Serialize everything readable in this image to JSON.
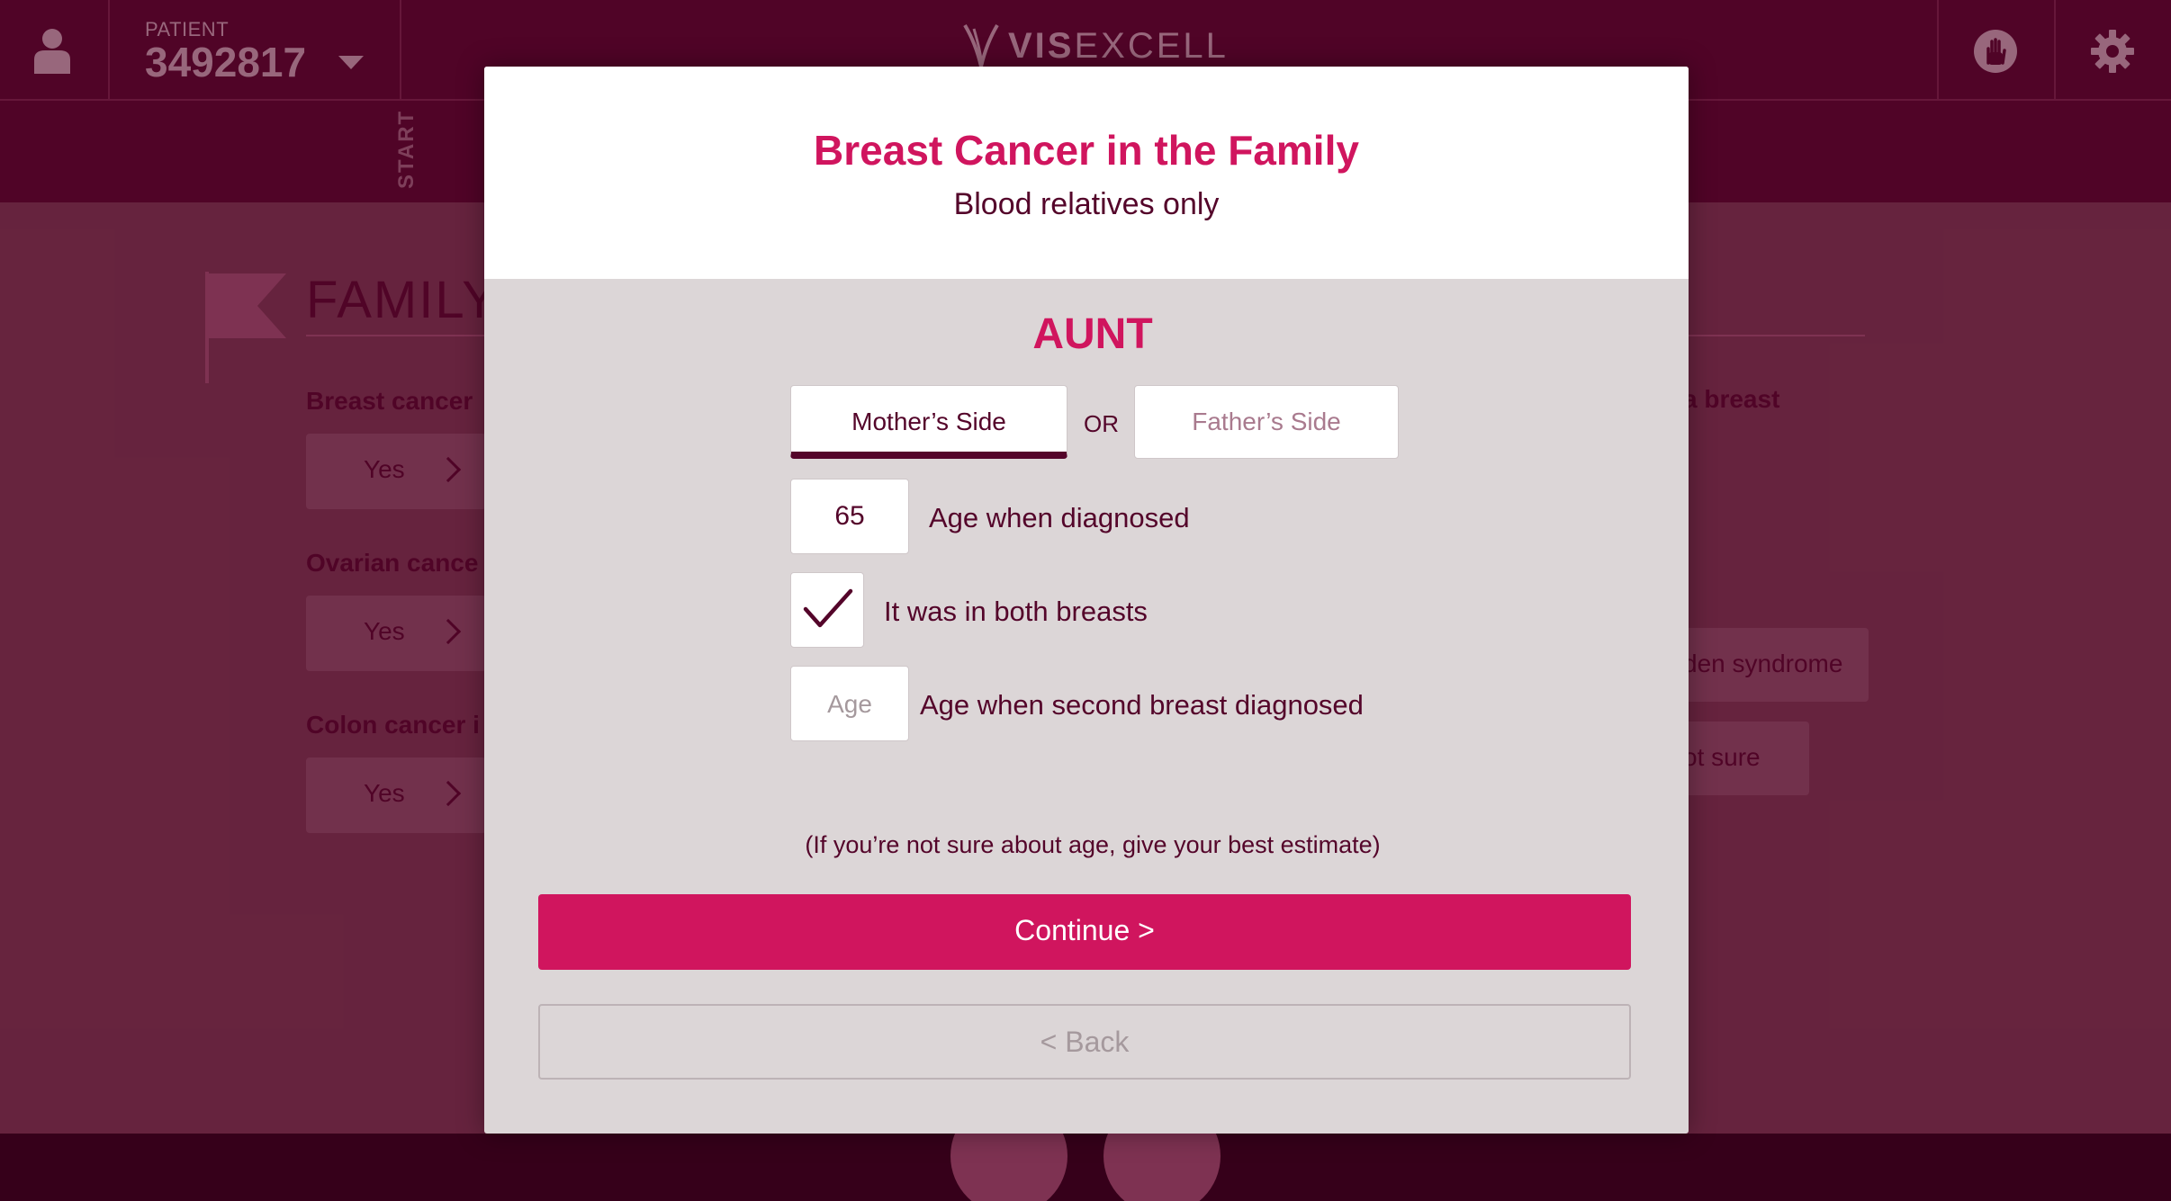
{
  "header": {
    "patient_label": "PATIENT",
    "patient_id": "3492817",
    "logo_bold": "VIS",
    "logo_light": "EXCELL"
  },
  "stepbar": {
    "start_label": "START"
  },
  "background": {
    "section_title": "FAMILY",
    "questions": [
      {
        "label": "Breast cancer",
        "answer": "Yes"
      },
      {
        "label": "Ovarian cance",
        "answer": "Yes"
      },
      {
        "label": "Colon cancer i",
        "answer": "Yes"
      }
    ],
    "right_label": "a breast",
    "right_options": [
      "den syndrome",
      "ot sure"
    ]
  },
  "modal": {
    "title": "Breast Cancer in the Family",
    "subtitle": "Blood relatives only",
    "relative": "AUNT",
    "side_mother": "Mother’s Side",
    "or_text": "OR",
    "side_father": "Father’s Side",
    "age_value": "65",
    "age_label": "Age when diagnosed",
    "both_breasts_checked": true,
    "both_breasts_label": "It was in both breasts",
    "age2_placeholder": "Age",
    "age2_label": "Age when second breast diagnosed",
    "hint": "(If you’re not sure about age, give your best estimate)",
    "continue_label": "Continue >",
    "back_label": "< Back"
  },
  "colors": {
    "brand_dark": "#54052a",
    "accent": "#d0155e",
    "modal_body": "#dcd6d7"
  }
}
